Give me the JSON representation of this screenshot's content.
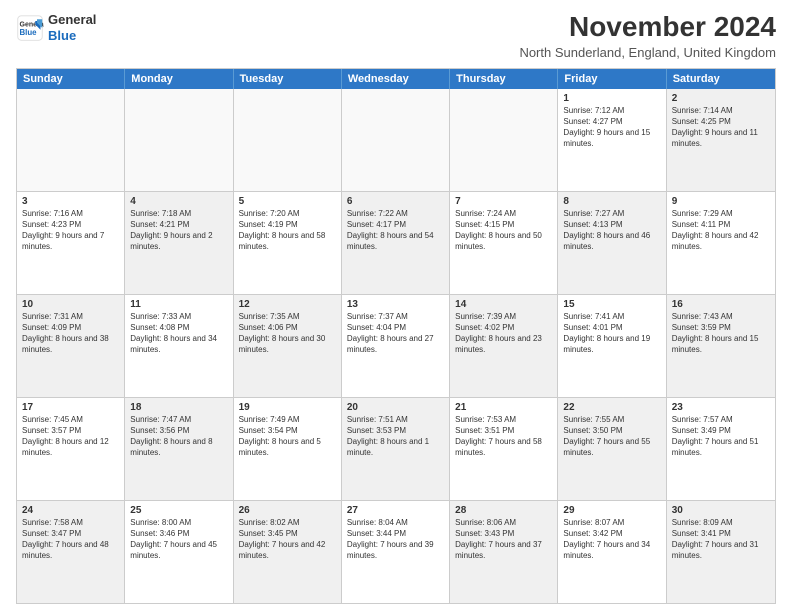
{
  "header": {
    "logo_line1": "General",
    "logo_line2": "Blue",
    "month_title": "November 2024",
    "location": "North Sunderland, England, United Kingdom"
  },
  "weekdays": [
    "Sunday",
    "Monday",
    "Tuesday",
    "Wednesday",
    "Thursday",
    "Friday",
    "Saturday"
  ],
  "rows": [
    [
      {
        "day": "",
        "text": "",
        "empty": true
      },
      {
        "day": "",
        "text": "",
        "empty": true
      },
      {
        "day": "",
        "text": "",
        "empty": true
      },
      {
        "day": "",
        "text": "",
        "empty": true
      },
      {
        "day": "",
        "text": "",
        "empty": true
      },
      {
        "day": "1",
        "text": "Sunrise: 7:12 AM\nSunset: 4:27 PM\nDaylight: 9 hours and 15 minutes.",
        "shaded": false
      },
      {
        "day": "2",
        "text": "Sunrise: 7:14 AM\nSunset: 4:25 PM\nDaylight: 9 hours and 11 minutes.",
        "shaded": true
      }
    ],
    [
      {
        "day": "3",
        "text": "Sunrise: 7:16 AM\nSunset: 4:23 PM\nDaylight: 9 hours and 7 minutes.",
        "shaded": false
      },
      {
        "day": "4",
        "text": "Sunrise: 7:18 AM\nSunset: 4:21 PM\nDaylight: 9 hours and 2 minutes.",
        "shaded": true
      },
      {
        "day": "5",
        "text": "Sunrise: 7:20 AM\nSunset: 4:19 PM\nDaylight: 8 hours and 58 minutes.",
        "shaded": false
      },
      {
        "day": "6",
        "text": "Sunrise: 7:22 AM\nSunset: 4:17 PM\nDaylight: 8 hours and 54 minutes.",
        "shaded": true
      },
      {
        "day": "7",
        "text": "Sunrise: 7:24 AM\nSunset: 4:15 PM\nDaylight: 8 hours and 50 minutes.",
        "shaded": false
      },
      {
        "day": "8",
        "text": "Sunrise: 7:27 AM\nSunset: 4:13 PM\nDaylight: 8 hours and 46 minutes.",
        "shaded": true
      },
      {
        "day": "9",
        "text": "Sunrise: 7:29 AM\nSunset: 4:11 PM\nDaylight: 8 hours and 42 minutes.",
        "shaded": false
      }
    ],
    [
      {
        "day": "10",
        "text": "Sunrise: 7:31 AM\nSunset: 4:09 PM\nDaylight: 8 hours and 38 minutes.",
        "shaded": true
      },
      {
        "day": "11",
        "text": "Sunrise: 7:33 AM\nSunset: 4:08 PM\nDaylight: 8 hours and 34 minutes.",
        "shaded": false
      },
      {
        "day": "12",
        "text": "Sunrise: 7:35 AM\nSunset: 4:06 PM\nDaylight: 8 hours and 30 minutes.",
        "shaded": true
      },
      {
        "day": "13",
        "text": "Sunrise: 7:37 AM\nSunset: 4:04 PM\nDaylight: 8 hours and 27 minutes.",
        "shaded": false
      },
      {
        "day": "14",
        "text": "Sunrise: 7:39 AM\nSunset: 4:02 PM\nDaylight: 8 hours and 23 minutes.",
        "shaded": true
      },
      {
        "day": "15",
        "text": "Sunrise: 7:41 AM\nSunset: 4:01 PM\nDaylight: 8 hours and 19 minutes.",
        "shaded": false
      },
      {
        "day": "16",
        "text": "Sunrise: 7:43 AM\nSunset: 3:59 PM\nDaylight: 8 hours and 15 minutes.",
        "shaded": true
      }
    ],
    [
      {
        "day": "17",
        "text": "Sunrise: 7:45 AM\nSunset: 3:57 PM\nDaylight: 8 hours and 12 minutes.",
        "shaded": false
      },
      {
        "day": "18",
        "text": "Sunrise: 7:47 AM\nSunset: 3:56 PM\nDaylight: 8 hours and 8 minutes.",
        "shaded": true
      },
      {
        "day": "19",
        "text": "Sunrise: 7:49 AM\nSunset: 3:54 PM\nDaylight: 8 hours and 5 minutes.",
        "shaded": false
      },
      {
        "day": "20",
        "text": "Sunrise: 7:51 AM\nSunset: 3:53 PM\nDaylight: 8 hours and 1 minute.",
        "shaded": true
      },
      {
        "day": "21",
        "text": "Sunrise: 7:53 AM\nSunset: 3:51 PM\nDaylight: 7 hours and 58 minutes.",
        "shaded": false
      },
      {
        "day": "22",
        "text": "Sunrise: 7:55 AM\nSunset: 3:50 PM\nDaylight: 7 hours and 55 minutes.",
        "shaded": true
      },
      {
        "day": "23",
        "text": "Sunrise: 7:57 AM\nSunset: 3:49 PM\nDaylight: 7 hours and 51 minutes.",
        "shaded": false
      }
    ],
    [
      {
        "day": "24",
        "text": "Sunrise: 7:58 AM\nSunset: 3:47 PM\nDaylight: 7 hours and 48 minutes.",
        "shaded": true
      },
      {
        "day": "25",
        "text": "Sunrise: 8:00 AM\nSunset: 3:46 PM\nDaylight: 7 hours and 45 minutes.",
        "shaded": false
      },
      {
        "day": "26",
        "text": "Sunrise: 8:02 AM\nSunset: 3:45 PM\nDaylight: 7 hours and 42 minutes.",
        "shaded": true
      },
      {
        "day": "27",
        "text": "Sunrise: 8:04 AM\nSunset: 3:44 PM\nDaylight: 7 hours and 39 minutes.",
        "shaded": false
      },
      {
        "day": "28",
        "text": "Sunrise: 8:06 AM\nSunset: 3:43 PM\nDaylight: 7 hours and 37 minutes.",
        "shaded": true
      },
      {
        "day": "29",
        "text": "Sunrise: 8:07 AM\nSunset: 3:42 PM\nDaylight: 7 hours and 34 minutes.",
        "shaded": false
      },
      {
        "day": "30",
        "text": "Sunrise: 8:09 AM\nSunset: 3:41 PM\nDaylight: 7 hours and 31 minutes.",
        "shaded": true
      }
    ]
  ]
}
